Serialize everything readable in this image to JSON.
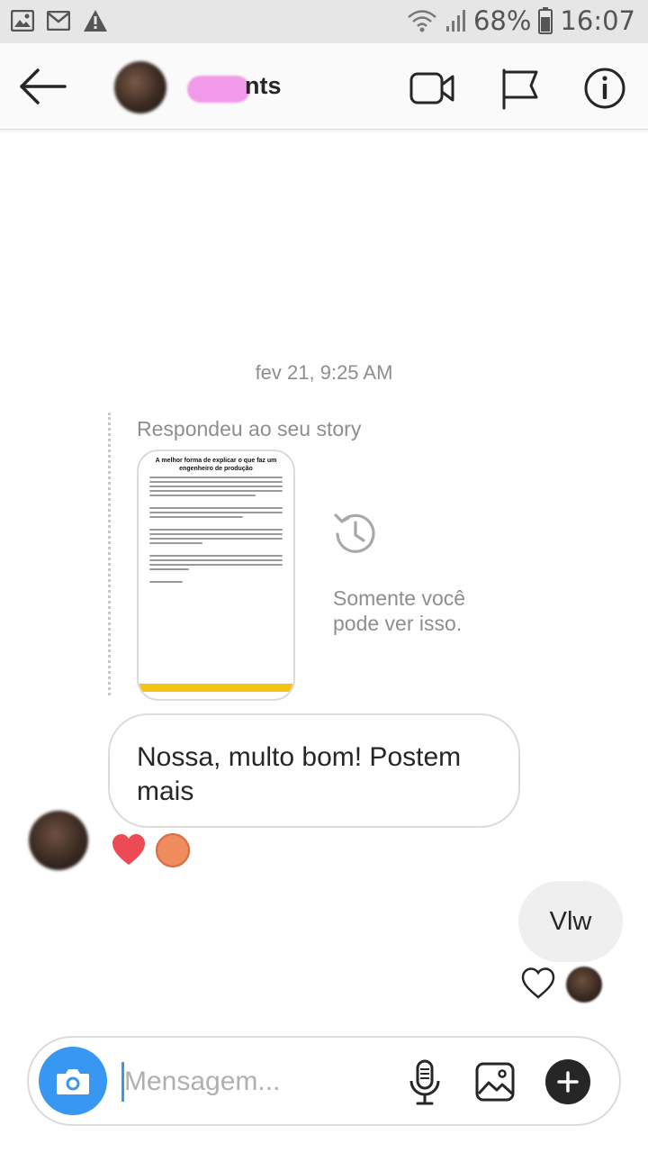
{
  "status_bar": {
    "battery": "68%",
    "time": "16:07",
    "icons": [
      "image-icon",
      "gmail-icon",
      "warning-icon",
      "wifi-icon",
      "signal-icon",
      "battery-icon"
    ]
  },
  "header": {
    "name": "nts",
    "icons": [
      "back-arrow-icon",
      "video-call-icon",
      "flag-icon",
      "info-icon"
    ]
  },
  "conversation": {
    "timestamp": "fev 21, 9:25 AM",
    "reply_caption": "Respondeu ao seu story",
    "story": {
      "title": "A melhor forma de explicar o que faz um engenheiro de produção",
      "footer_color": "#f5c311"
    },
    "only_you_text": "Somente você pode ver isso.",
    "incoming_message": "Nossa, multo bom! Postem mais",
    "reactions": [
      "heart-icon"
    ],
    "outgoing_message": "Vlw"
  },
  "composer": {
    "placeholder": "Mensagem...",
    "value": "",
    "icons": [
      "camera-icon",
      "microphone-icon",
      "image-icon",
      "plus-icon"
    ]
  },
  "colors": {
    "accent": "#3897f0",
    "heart": "#ed4956",
    "bubble_out": "#efefef",
    "name_blur": "#f19ae9"
  }
}
